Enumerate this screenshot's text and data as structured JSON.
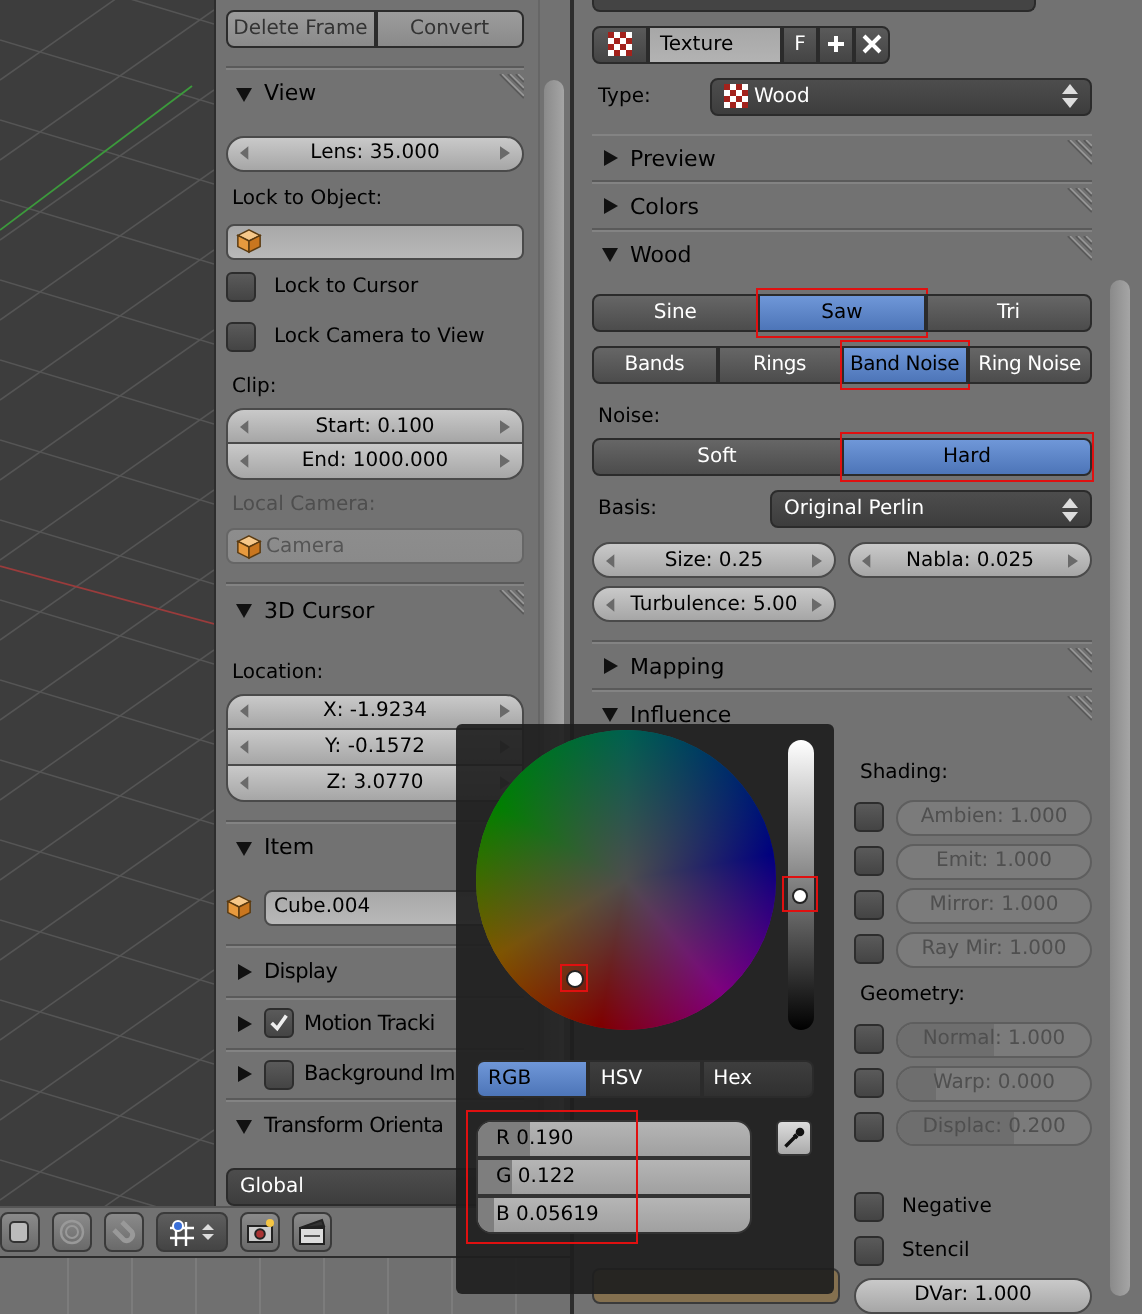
{
  "frame_buttons": [
    "Delete Frame",
    "Convert"
  ],
  "view": {
    "title": "View",
    "expanded": true,
    "lens": "Lens: 35.000",
    "lock_label": "Lock to Object:",
    "lock_to_cursor": {
      "label": "Lock to Cursor",
      "checked": false
    },
    "lock_camera": {
      "label": "Lock Camera to View",
      "checked": false
    },
    "clip_label": "Clip:",
    "clip": [
      "Start: 0.100",
      "End: 1000.000"
    ],
    "local_camera_label": "Local Camera:",
    "local_camera": {
      "value": "Camera",
      "disabled": true
    }
  },
  "cursor": {
    "title": "3D Cursor",
    "expanded": true,
    "location_label": "Location:",
    "location": [
      "X: -1.9234",
      "Y: -0.1572",
      "Z: 3.0770"
    ]
  },
  "item": {
    "title": "Item",
    "expanded": true,
    "name": "Cube.004"
  },
  "lower_panels": [
    {
      "title": "Display",
      "expanded": false,
      "kind": "plain"
    },
    {
      "title": "Motion Tracki",
      "expanded": false,
      "kind": "toggle",
      "checked": true
    },
    {
      "title": "Background Im",
      "expanded": false,
      "kind": "toggle",
      "checked": false
    },
    {
      "title": "Transform Orienta",
      "expanded": true,
      "kind": "plain"
    }
  ],
  "orientation": "Global",
  "texture": {
    "name": "Texture",
    "fake_user": "F",
    "type_label": "Type:",
    "type": "Wood"
  },
  "texture_panels": [
    {
      "title": "Preview",
      "expanded": false
    },
    {
      "title": "Colors",
      "expanded": false
    },
    {
      "title": "Wood",
      "expanded": true
    }
  ],
  "wood": {
    "profile": [
      {
        "label": "Sine",
        "selected": false,
        "annotated": false
      },
      {
        "label": "Saw",
        "selected": true,
        "annotated": true
      },
      {
        "label": "Tri",
        "selected": false,
        "annotated": false
      }
    ],
    "pattern": [
      {
        "label": "Bands",
        "selected": false,
        "annotated": false
      },
      {
        "label": "Rings",
        "selected": false,
        "annotated": false
      },
      {
        "label": "Band Noise",
        "selected": true,
        "annotated": true
      },
      {
        "label": "Ring Noise",
        "selected": false,
        "annotated": false
      }
    ],
    "noise_label": "Noise:",
    "noise": [
      {
        "label": "Soft",
        "selected": false,
        "annotated": false
      },
      {
        "label": "Hard",
        "selected": true,
        "annotated": true
      }
    ],
    "basis_label": "Basis:",
    "basis": "Original Perlin",
    "size": "Size: 0.25",
    "nabla": "Nabla: 0.025",
    "turbulence": "Turbulence: 5.00"
  },
  "mapping": {
    "title": "Mapping",
    "expanded": false
  },
  "influence": {
    "title": "Influence",
    "expanded": true,
    "shading_label": "Shading:",
    "shading": [
      {
        "label": "Ambien: 1.000",
        "checked": false
      },
      {
        "label": "Emit: 1.000",
        "checked": false
      },
      {
        "label": "Mirror: 1.000",
        "checked": false
      },
      {
        "label": "Ray Mir: 1.000",
        "checked": false
      }
    ],
    "geometry_label": "Geometry:",
    "geometry": [
      {
        "label": "Normal: 1.000",
        "checked": false,
        "level": 0.5
      },
      {
        "label": "Warp: 0.000",
        "checked": false,
        "level": 0.2
      },
      {
        "label": "Displac: 0.200",
        "checked": false,
        "level": 0.6
      }
    ],
    "negative": {
      "label": "Negative",
      "checked": false
    },
    "stencil": {
      "label": "Stencil",
      "checked": false
    },
    "color": "#84704f",
    "dvar": "DVar: 1.000"
  },
  "color_picker": {
    "value_slider": {
      "level": 0.46,
      "annotated": true
    },
    "wheel_annotated": true,
    "modes": [
      {
        "label": "RGB",
        "selected": true
      },
      {
        "label": "HSV",
        "selected": false
      },
      {
        "label": "Hex",
        "selected": false
      }
    ],
    "channels": [
      {
        "label": "R 0.190",
        "level": 0.19
      },
      {
        "label": "G 0.122",
        "level": 0.122
      },
      {
        "label": "B 0.05619",
        "level": 0.056
      }
    ],
    "channels_annotated": true
  }
}
